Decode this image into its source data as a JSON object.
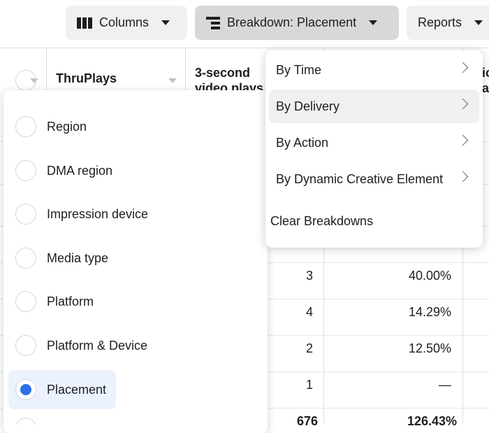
{
  "toolbar": {
    "columns_label": "Columns",
    "breakdown_label": "Breakdown: Placement",
    "reports_label": "Reports",
    "icons": {
      "columns": "columns-icon",
      "breakdown": "breakdown-icon"
    }
  },
  "table": {
    "headers": [
      "",
      "ThruPlays",
      "3-second video plays",
      "ic a"
    ],
    "rows": [
      {
        "plays": "3",
        "rate": "40.00%"
      },
      {
        "plays": "4",
        "rate": "14.29%"
      },
      {
        "plays": "2",
        "rate": "12.50%"
      },
      {
        "plays": "1",
        "rate": "—"
      }
    ],
    "total": {
      "plays": "676",
      "rate": "126.43%"
    }
  },
  "delivery_options": {
    "items": [
      {
        "label": "Region",
        "selected": false
      },
      {
        "label": "DMA region",
        "selected": false
      },
      {
        "label": "Impression device",
        "selected": false
      },
      {
        "label": "Media type",
        "selected": false
      },
      {
        "label": "Platform",
        "selected": false
      },
      {
        "label": "Platform & Device",
        "selected": false
      },
      {
        "label": "Placement",
        "selected": true
      }
    ]
  },
  "breakdown_menu": {
    "items": [
      {
        "label": "By Time",
        "submenu": true
      },
      {
        "label": "By Delivery",
        "submenu": true,
        "highlighted": true
      },
      {
        "label": "By Action",
        "submenu": true
      },
      {
        "label": "By Dynamic Creative Element",
        "submenu": true
      }
    ],
    "clear_label": "Clear Breakdowns"
  },
  "colors": {
    "accent": "#2d6fe6",
    "selected_bg": "#ebf2fd",
    "button_bg": "#f0f0f0",
    "button_active_bg": "#d8d8d8"
  }
}
